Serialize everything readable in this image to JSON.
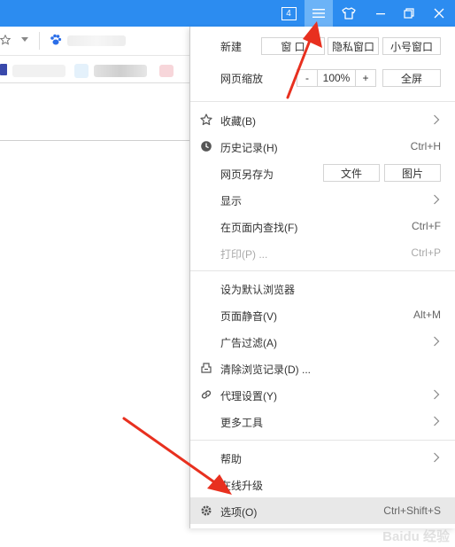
{
  "titlebar": {
    "tab_count": "4",
    "colors": {
      "bar": "#2c8cf0",
      "active_button": "#6cb3f7"
    }
  },
  "menu": {
    "new_row": {
      "label": "新建",
      "window": "窗 口",
      "private_window": "隐私窗口",
      "small_window": "小号窗口"
    },
    "zoom_row": {
      "label": "网页缩放",
      "minus": "-",
      "value": "100%",
      "plus": "+",
      "fullscreen": "全屏"
    },
    "items": {
      "favorites": {
        "label": "收藏(B)"
      },
      "history": {
        "label": "历史记录(H)",
        "shortcut": "Ctrl+H"
      },
      "save_as": {
        "label": "网页另存为",
        "file": "文件",
        "image": "图片"
      },
      "display": {
        "label": "显示"
      },
      "find": {
        "label": "在页面内查找(F)",
        "shortcut": "Ctrl+F"
      },
      "print": {
        "label": "打印(P) ...",
        "shortcut": "Ctrl+P"
      },
      "set_default": {
        "label": "设为默认浏览器"
      },
      "mute": {
        "label": "页面静音(V)",
        "shortcut": "Alt+M"
      },
      "ad_filter": {
        "label": "广告过滤(A)"
      },
      "clear_history": {
        "label": "清除浏览记录(D) ..."
      },
      "proxy": {
        "label": "代理设置(Y)"
      },
      "more_tools": {
        "label": "更多工具"
      },
      "help": {
        "label": "帮助"
      },
      "update": {
        "label": "在线升级"
      },
      "options": {
        "label": "选项(O)",
        "shortcut": "Ctrl+Shift+S"
      }
    }
  },
  "watermark": {
    "text": "Baidu 经验"
  }
}
